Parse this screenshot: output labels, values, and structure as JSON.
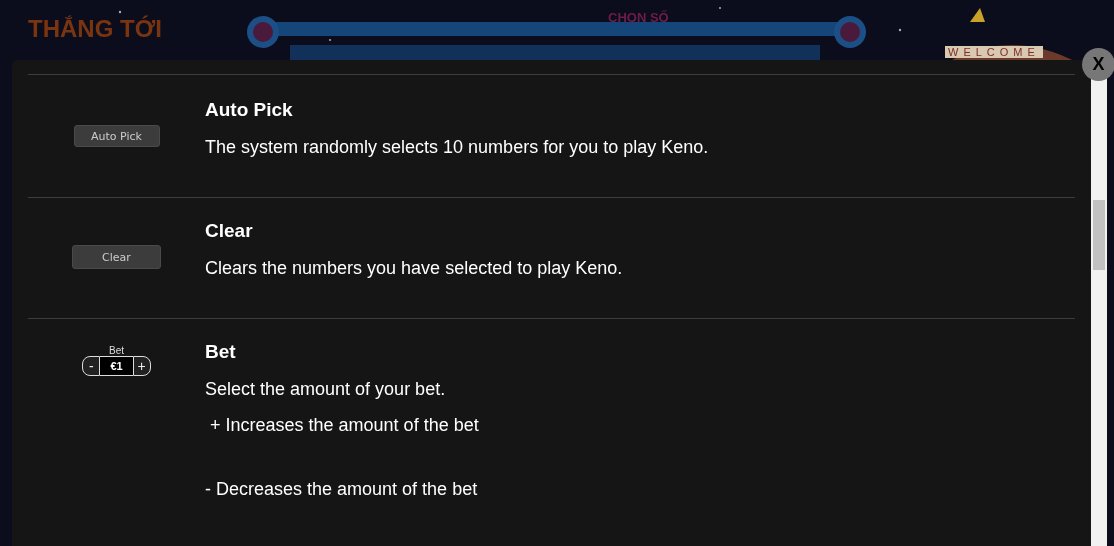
{
  "game": {
    "title": "THẮNG TỚI",
    "panel_label": "CHỌN SỐ",
    "sign": "WELCOME"
  },
  "dialog": {
    "close": "X",
    "items": [
      {
        "kind": "button",
        "control": "Auto Pick",
        "title": "Auto Pick",
        "lines": [
          "The system randomly selects 10 numbers for you to play Keno."
        ]
      },
      {
        "kind": "button",
        "control": "Clear",
        "title": "Clear",
        "lines": [
          "Clears the numbers you have selected to play Keno."
        ]
      },
      {
        "kind": "stepper",
        "control_label": "Bet",
        "control": "€1",
        "minus": "-",
        "plus": "+",
        "title": "Bet",
        "lines": [
          "Select the amount of your bet.",
          " + Increases the amount of the bet"
        ],
        "extra_line": "- Decreases the amount of the bet"
      }
    ]
  }
}
